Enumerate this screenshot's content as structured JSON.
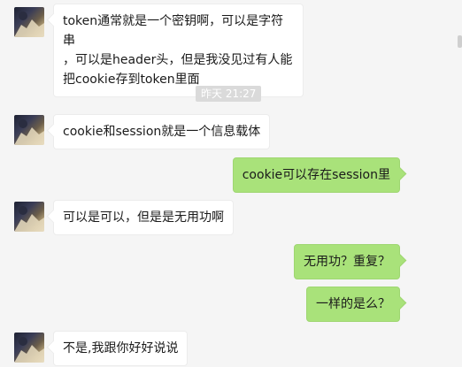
{
  "chat": {
    "timestamp": "昨天 21:27",
    "messages": [
      {
        "dir": "in",
        "text": "token通常就是一个密钥啊，可以是字符串\n，可以是header头，但是我没见过有人能\n把cookie存到token里面"
      },
      {
        "dir": "in",
        "text": "cookie和session就是一个信息载体"
      },
      {
        "dir": "out",
        "text": "cookie可以存在session里"
      },
      {
        "dir": "in",
        "text": "可以是可以，但是是无用功啊"
      },
      {
        "dir": "out",
        "text": "无用功？重复？"
      },
      {
        "dir": "out",
        "text": "一样的是么？"
      },
      {
        "dir": "in",
        "text": "不是,我跟你好好说说"
      }
    ]
  },
  "colors": {
    "background": "#f5f5f5",
    "incoming_bubble": "#ffffff",
    "outgoing_bubble": "#a9e27a",
    "timestamp_bg": "#dadada"
  },
  "icons": {
    "avatar": "contact-avatar"
  }
}
